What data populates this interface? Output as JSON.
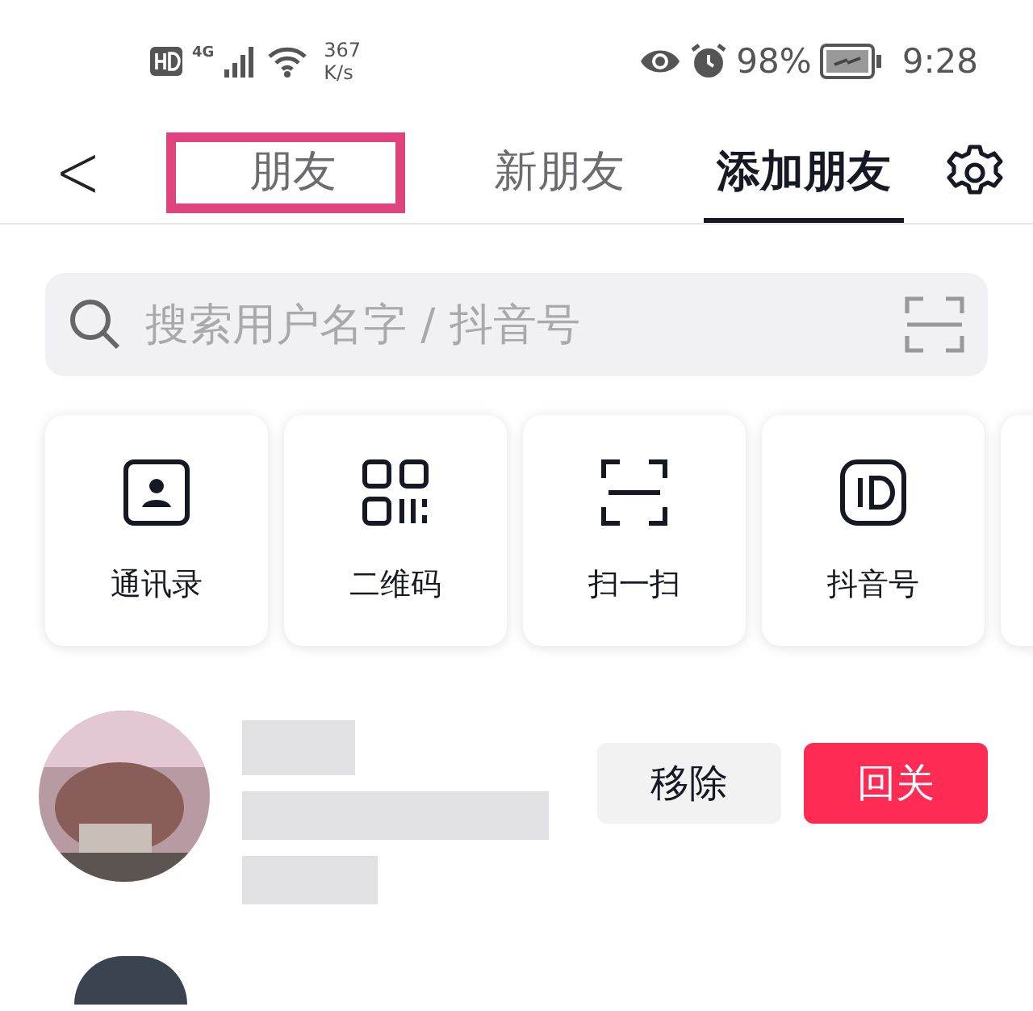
{
  "status_bar": {
    "network": "4G",
    "speed_value": "367",
    "speed_unit": "K/s",
    "battery": "98%",
    "time": "9:28"
  },
  "nav": {
    "back": "<",
    "tabs": [
      {
        "label": "朋友",
        "selected": false,
        "highlighted": true
      },
      {
        "label": "新朋友",
        "selected": false,
        "highlighted": false
      },
      {
        "label": "添加朋友",
        "selected": true,
        "highlighted": false
      }
    ]
  },
  "search": {
    "placeholder": "搜索用户名字 / 抖音号"
  },
  "shortcuts": [
    {
      "kind": "contacts",
      "label": "通讯录"
    },
    {
      "kind": "qrcode",
      "label": "二维码"
    },
    {
      "kind": "scan",
      "label": "扫一扫"
    },
    {
      "kind": "id",
      "label": "抖音号"
    }
  ],
  "contact": {
    "buttons": [
      {
        "kind": "secondary",
        "label": "移除"
      },
      {
        "kind": "primary",
        "label": "回关"
      }
    ]
  }
}
